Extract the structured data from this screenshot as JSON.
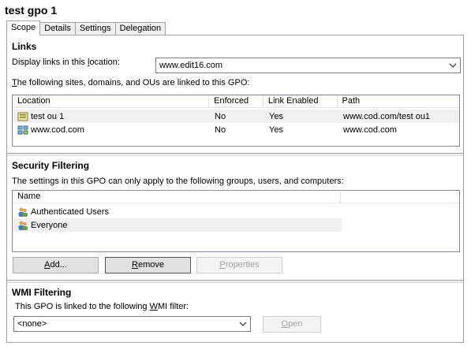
{
  "title": "test gpo 1",
  "tabs": [
    "Scope",
    "Details",
    "Settings",
    "Delegation"
  ],
  "links": {
    "section_title": "Links",
    "display_label": "Display links in this location:",
    "display_value": "www.edit16.com",
    "linked_text": "The following sites, domains, and OUs are linked to this GPO:",
    "columns": [
      "Location",
      "Enforced",
      "Link Enabled",
      "Path"
    ],
    "rows": [
      {
        "location": "test ou 1",
        "enforced": "No",
        "link_enabled": "Yes",
        "path": "www.cod.com/test ou1",
        "icon": "ou-icon"
      },
      {
        "location": "www.cod.com",
        "enforced": "No",
        "link_enabled": "Yes",
        "path": "www.cod.com",
        "icon": "domain-icon"
      }
    ]
  },
  "security": {
    "section_title": "Security Filtering",
    "description": "The settings in this GPO can only apply to the following groups, users, and computers:",
    "column": "Name",
    "rows": [
      {
        "name": "Authenticated Users",
        "icon": "users-group-icon"
      },
      {
        "name": "Everyone",
        "icon": "users-group-icon"
      }
    ],
    "add_label": "Add...",
    "remove_label": "Remove",
    "properties_label": "Properties"
  },
  "wmi": {
    "section_title": "WMI Filtering",
    "description": "This GPO is linked to the following WMI filter:",
    "filter_value": "<none>",
    "open_label": "Open"
  }
}
